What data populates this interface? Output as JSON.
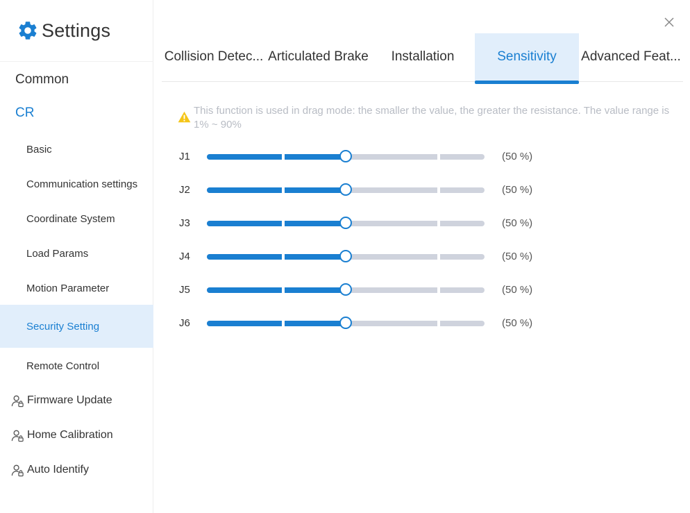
{
  "app": {
    "title": "Settings"
  },
  "sidebar": {
    "items": [
      {
        "label": "Common"
      },
      {
        "label": "CR"
      },
      {
        "label": "Basic"
      },
      {
        "label": "Communication settings"
      },
      {
        "label": "Coordinate System"
      },
      {
        "label": "Load Params"
      },
      {
        "label": "Motion Parameter"
      },
      {
        "label": "Security Setting"
      },
      {
        "label": "Remote Control"
      },
      {
        "label": "Firmware Update",
        "icon": "user-lock-icon"
      },
      {
        "label": "Home Calibration",
        "icon": "user-lock-icon"
      },
      {
        "label": "Auto Identify",
        "icon": "user-lock-icon"
      }
    ],
    "selected": "Security Setting"
  },
  "tabs": {
    "items": [
      {
        "label": "Collision Detec..."
      },
      {
        "label": "Articulated Brake"
      },
      {
        "label": "Installation"
      },
      {
        "label": "Sensitivity"
      },
      {
        "label": "Advanced Feat..."
      }
    ],
    "active": "Sensitivity"
  },
  "notice": {
    "icon": "warning-icon",
    "text": "This function is used in drag mode: the smaller the value, the greater the resistance. The value range is 1% ~ 90%"
  },
  "sliders": [
    {
      "label": "J1",
      "value": 50,
      "value_text": "(50 %)"
    },
    {
      "label": "J2",
      "value": 50,
      "value_text": "(50 %)"
    },
    {
      "label": "J3",
      "value": 50,
      "value_text": "(50 %)"
    },
    {
      "label": "J4",
      "value": 50,
      "value_text": "(50 %)"
    },
    {
      "label": "J5",
      "value": 50,
      "value_text": "(50 %)"
    },
    {
      "label": "J6",
      "value": 50,
      "value_text": "(50 %)"
    }
  ],
  "colors": {
    "accent": "#1a7fd1",
    "selected_bg": "#e1eefb",
    "track": "#cfd3dd",
    "warning": "#f5c518",
    "notice_text": "#b8bcc4"
  }
}
